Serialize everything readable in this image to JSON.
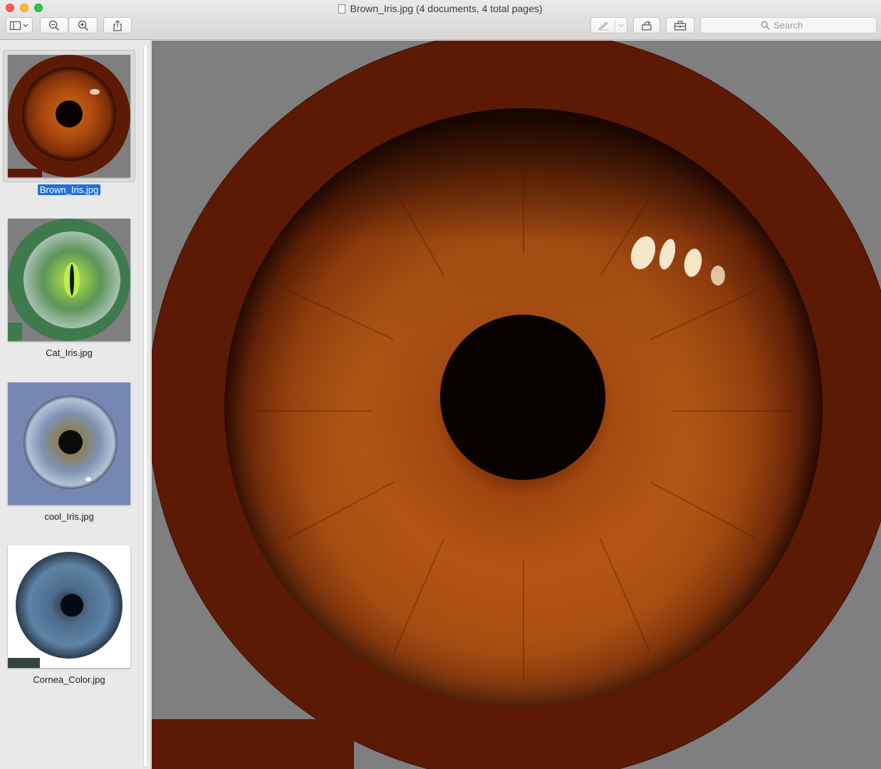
{
  "window": {
    "title": "Brown_Iris.jpg (4 documents, 4 total pages)"
  },
  "toolbar": {
    "buttons": [
      {
        "name": "sidebar-toggle-button",
        "icon": "sidebar-icon"
      },
      {
        "name": "zoom-out-button",
        "icon": "zoom-out-icon"
      },
      {
        "name": "zoom-in-button",
        "icon": "zoom-in-icon"
      },
      {
        "name": "share-button",
        "icon": "share-icon"
      },
      {
        "name": "markup-button",
        "icon": "pen-icon"
      },
      {
        "name": "rotate-button",
        "icon": "rotate-icon"
      },
      {
        "name": "toolbox-button",
        "icon": "toolbox-icon"
      }
    ],
    "search_placeholder": "Search"
  },
  "sidebar": {
    "items": [
      {
        "label": "Brown_Iris.jpg",
        "selected": true,
        "ring_color": "#5c1a05",
        "bg_color": "#7f7f7f"
      },
      {
        "label": "Cat_Iris.jpg",
        "selected": false,
        "ring_color": "#3f7a4e",
        "bg_color": "#7f7f7f"
      },
      {
        "label": "cool_Iris.jpg",
        "selected": false,
        "ring_color": "#7688b2",
        "bg_color": "#7688b2"
      },
      {
        "label": "Cornea_Color.jpg",
        "selected": false,
        "ring_color": "#ffffff",
        "bg_color": "#ffffff"
      }
    ]
  },
  "colors": {
    "ring": "#5c1a05",
    "canvas_bg": "#7f7f7f",
    "iris_mid": "#a4430f",
    "pupil": "#080200",
    "selection": "#1f6fdc"
  }
}
